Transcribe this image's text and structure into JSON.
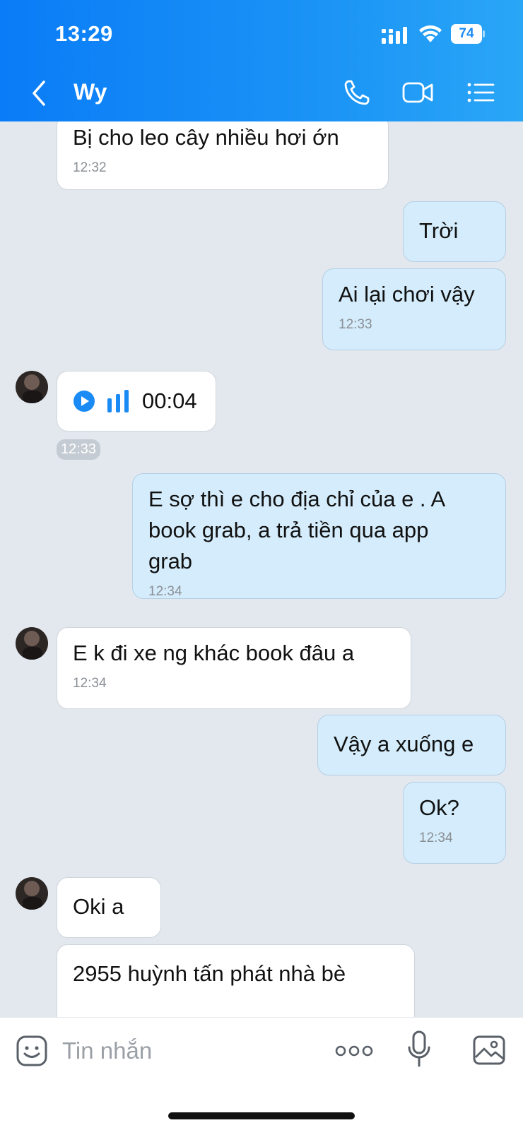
{
  "status_bar": {
    "time": "13:29",
    "battery": "74"
  },
  "header": {
    "contact_name": "Wy"
  },
  "messages": [
    {
      "text": "Bị cho leo cây nhiều hơi ớn",
      "time": "12:32"
    },
    {
      "text": "Trời"
    },
    {
      "text": "Ai lại chơi vậy",
      "time": "12:33"
    },
    {
      "voice_duration": "00:04",
      "time": "12:33"
    },
    {
      "text_lines": [
        "E sợ thì e cho địa chỉ của e . A",
        "book grab, a trả tiền qua app",
        "grab"
      ],
      "time": "12:34"
    },
    {
      "text": "E k đi xe ng khác book đâu a",
      "time": "12:34"
    },
    {
      "text": "Vậy a xuống e"
    },
    {
      "text": "Ok?",
      "time": "12:34"
    },
    {
      "text": "Oki a"
    },
    {
      "text": "2955 huỳnh tấn phát nhà bè"
    }
  ],
  "input": {
    "placeholder": "Tin nhắn"
  },
  "colors": {
    "header_gradient_start": "#0a7cf7",
    "header_gradient_end": "#2aa6f7",
    "outgoing_bubble": "#d4ecfb",
    "incoming_bubble": "#ffffff",
    "chat_background": "#e3e8ef",
    "accent": "#1a8af5"
  }
}
